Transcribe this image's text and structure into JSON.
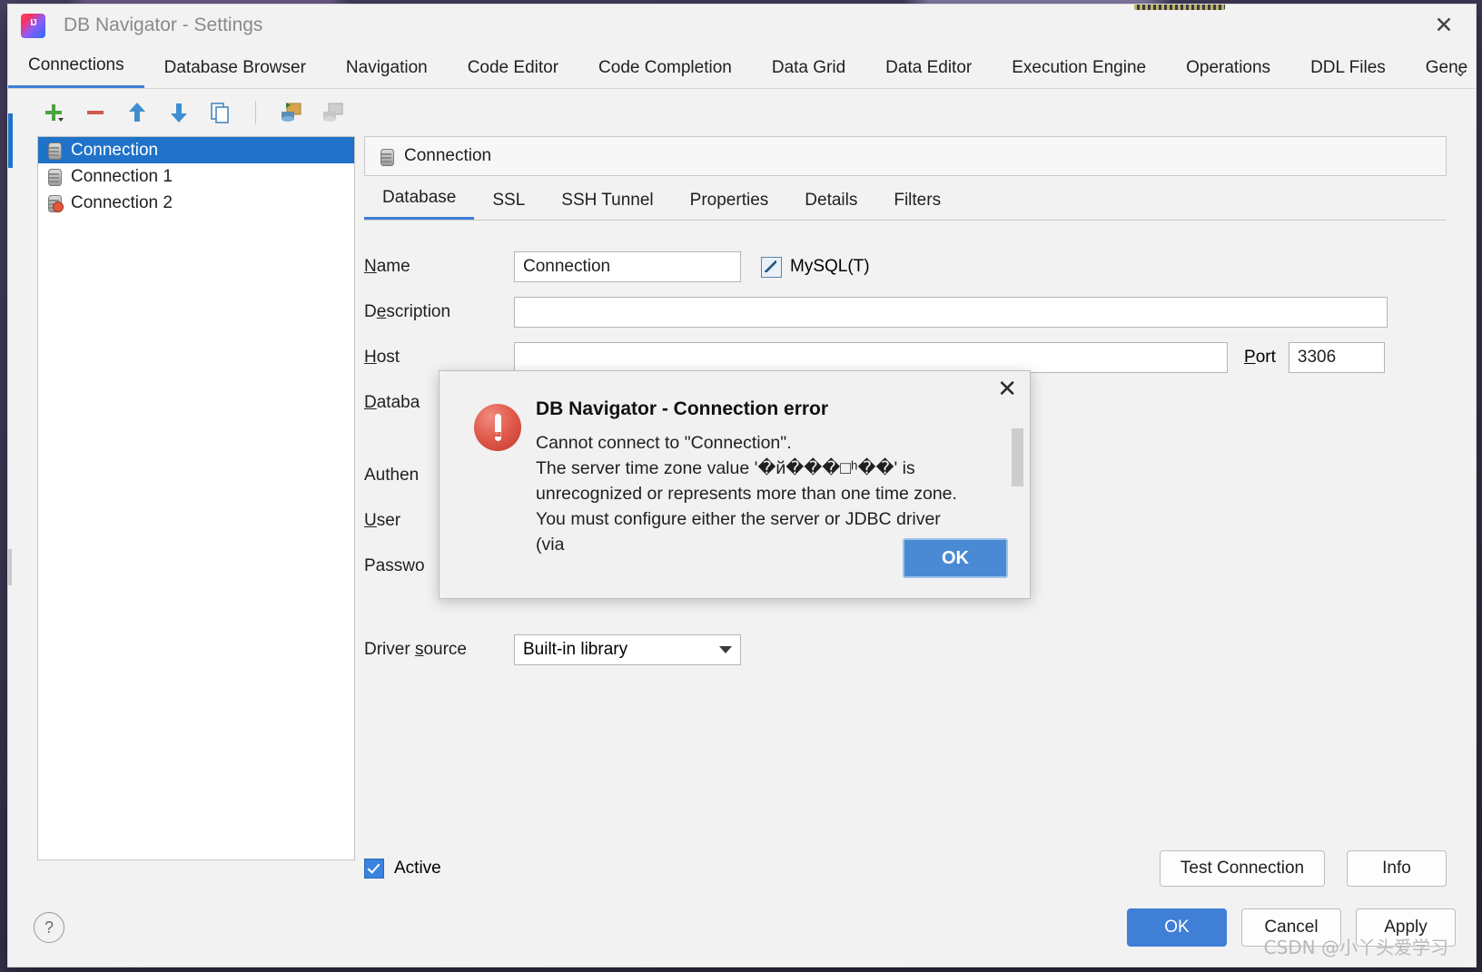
{
  "window": {
    "title": "DB Navigator - Settings",
    "logo_text": "IJ",
    "close_label": "✕"
  },
  "tabs": [
    {
      "label": "Connections",
      "active": true
    },
    {
      "label": "Database Browser",
      "active": false
    },
    {
      "label": "Navigation",
      "active": false
    },
    {
      "label": "Code Editor",
      "active": false
    },
    {
      "label": "Code Completion",
      "active": false
    },
    {
      "label": "Data Grid",
      "active": false
    },
    {
      "label": "Data Editor",
      "active": false
    },
    {
      "label": "Execution Engine",
      "active": false
    },
    {
      "label": "Operations",
      "active": false
    },
    {
      "label": "DDL Files",
      "active": false
    },
    {
      "label": "Gene",
      "active": false
    }
  ],
  "tabs_overflow_icon": "chevron-down-icon",
  "toolbar": {
    "add": "add-icon",
    "remove": "remove-icon",
    "move_up": "arrow-up-icon",
    "move_down": "arrow-down-icon",
    "copy": "copy-icon",
    "import": "import-connection-icon",
    "export": "export-connection-icon"
  },
  "connections": [
    {
      "name": "Connection",
      "selected": true,
      "error": false
    },
    {
      "name": "Connection 1",
      "selected": false,
      "error": false
    },
    {
      "name": "Connection 2",
      "selected": false,
      "error": true
    }
  ],
  "panel": {
    "header_title": "Connection",
    "subtabs": [
      {
        "label": "Database",
        "active": true
      },
      {
        "label": "SSL",
        "active": false
      },
      {
        "label": "SSH Tunnel",
        "active": false
      },
      {
        "label": "Properties",
        "active": false
      },
      {
        "label": "Details",
        "active": false
      },
      {
        "label": "Filters",
        "active": false
      }
    ]
  },
  "form": {
    "name_label": "Name",
    "name_value": "Connection",
    "database_type": "MySQL(T)",
    "description_label": "Description",
    "description_value": "",
    "host_label": "Host",
    "host_value": "",
    "port_label": "Port",
    "port_value": "3306",
    "database_label": "Databa",
    "authentication_label": "Authen",
    "user_label": "User",
    "password_label": "Passwo",
    "driver_source_label": "Driver source",
    "driver_source_value": "Built-in library",
    "active_label": "Active",
    "active_checked": true,
    "test_connection_label": "Test Connection",
    "info_label": "Info"
  },
  "footer": {
    "help_label": "?",
    "ok_label": "OK",
    "cancel_label": "Cancel",
    "apply_label": "Apply"
  },
  "error_dialog": {
    "title": "DB Navigator - Connection error",
    "message": "Cannot connect to \"Connection\".\nThe server time zone value '�й���□ʰ��' is\nunrecognized or represents more than one time zone.\nYou must configure either the server or JDBC driver (via",
    "ok_label": "OK",
    "close_label": "✕"
  },
  "watermark": "CSDN @小丫头爱学习",
  "colors": {
    "accent": "#3f7fd6",
    "selection": "#1f72c8",
    "error": "#e05a4b"
  }
}
